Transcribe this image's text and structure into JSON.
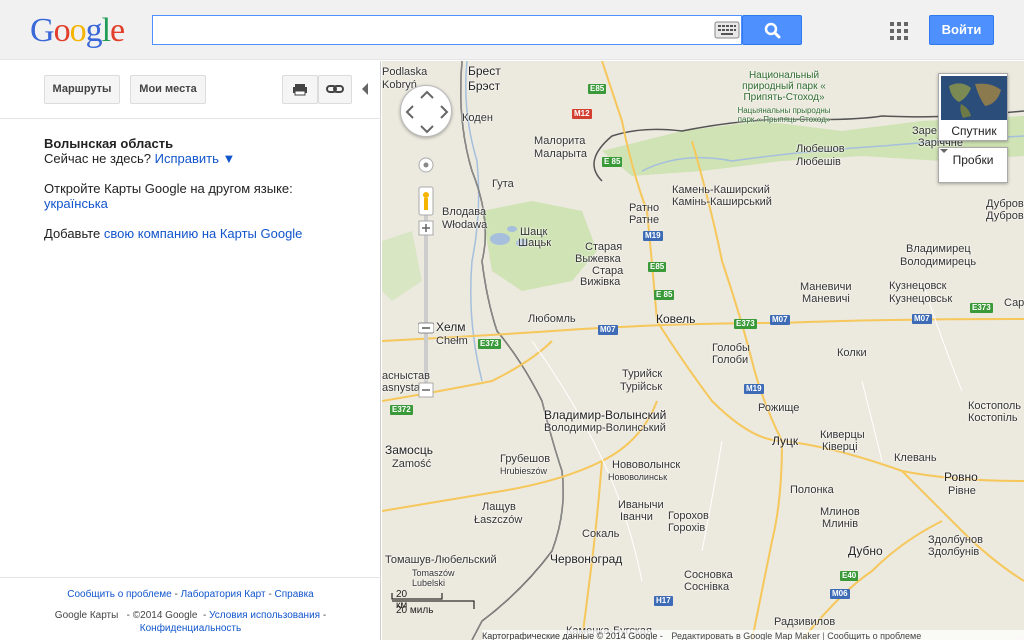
{
  "header": {
    "logo_letters": [
      "G",
      "o",
      "o",
      "g",
      "l",
      "e"
    ],
    "search_value": "",
    "signin_label": "Войти"
  },
  "panel": {
    "directions_label": "Маршруты",
    "my_places_label": "Мои места",
    "region_title": "Волынская область",
    "not_here_text": "Сейчас не здесь?",
    "fix_link": "Исправить ▼",
    "other_lang_text": "Откройте Карты Google на другом языке:",
    "lang_link": "українська",
    "add_text": "Добавьте",
    "add_link": "свою компанию на Карты Google"
  },
  "footer": {
    "report": "Сообщить о проблеме",
    "labs": "Лаборатория Карт",
    "help": "Справка",
    "product": "Google Карты",
    "copyright": "©2014 Google",
    "terms": "Условия использования",
    "privacy": "Конфиденциальность",
    "sep": " - "
  },
  "map": {
    "satellite_label": "Спутник",
    "traffic_label": "Пробки",
    "scale_km": "20 км",
    "scale_mi": "20 миль",
    "attribution": "Картографические данные © 2014 Google -",
    "edit_link": "Редактировать в Google Map Maker",
    "report_link": "Сообщить о проблеме",
    "colors": {
      "water": "#a5bfdd",
      "park": "#cfe3b4",
      "land": "#ece9de",
      "road": "#f6c75a",
      "border": "#555555"
    },
    "labels": [
      {
        "id": "podlaska",
        "t": "Podlaska"
      },
      {
        "id": "brest",
        "t": "Брест"
      },
      {
        "id": "brest2",
        "t": "Брэст"
      },
      {
        "id": "kobryn",
        "t": "Kobryń"
      },
      {
        "id": "kosen",
        "t": "Коден"
      },
      {
        "id": "maloryta",
        "t": "Малорита"
      },
      {
        "id": "maloryta2",
        "t": "Маларыта"
      },
      {
        "id": "park",
        "t": "Национальный природный парк « Припять-Стоход»"
      },
      {
        "id": "park2",
        "t": "Нацыянальны прыродны парк « Прыпяць-Стоход»"
      },
      {
        "id": "lubeshov",
        "t": "Любешов"
      },
      {
        "id": "lubeshov2",
        "t": "Любешів"
      },
      {
        "id": "zare",
        "t": "Заре"
      },
      {
        "id": "zare2",
        "t": "Заріччне"
      },
      {
        "id": "guta",
        "t": "Гута"
      },
      {
        "id": "kamen",
        "t": "Камень-Каширский"
      },
      {
        "id": "kamen2",
        "t": "Камінь-Каширський"
      },
      {
        "id": "ratno",
        "t": "Ратно"
      },
      {
        "id": "ratno2",
        "t": "Ратне"
      },
      {
        "id": "vlodava",
        "t": "Влодава"
      },
      {
        "id": "vlodava2",
        "t": "Włodawa"
      },
      {
        "id": "shatsk",
        "t": "Шацк"
      },
      {
        "id": "shatsk2",
        "t": "Шацьк"
      },
      {
        "id": "stara",
        "t": "Старая"
      },
      {
        "id": "vyzhev",
        "t": "Выжевка"
      },
      {
        "id": "stara2",
        "t": "Стара"
      },
      {
        "id": "vyzhev2",
        "t": "Вижівка"
      },
      {
        "id": "dubrov",
        "t": "Дубров"
      },
      {
        "id": "dubrov2",
        "t": "Дуброві"
      },
      {
        "id": "vladim",
        "t": "Владимирец"
      },
      {
        "id": "vladim2",
        "t": "Володимирець"
      },
      {
        "id": "manev",
        "t": "Маневичи"
      },
      {
        "id": "manev2",
        "t": "Маневичі"
      },
      {
        "id": "kuzn",
        "t": "Кузнецовск"
      },
      {
        "id": "kuzn2",
        "t": "Кузнецовськ"
      },
      {
        "id": "sar",
        "t": "Сар"
      },
      {
        "id": "kholm",
        "t": "Хелм"
      },
      {
        "id": "chelm",
        "t": "Chełm"
      },
      {
        "id": "lubom",
        "t": "Любомль"
      },
      {
        "id": "kovel",
        "t": "Ковель"
      },
      {
        "id": "goloby",
        "t": "Голобы"
      },
      {
        "id": "goloby2",
        "t": "Голоби"
      },
      {
        "id": "kolki",
        "t": "Колки"
      },
      {
        "id": "krasn",
        "t": "асныстав"
      },
      {
        "id": "krasn2",
        "t": "asnystaw"
      },
      {
        "id": "turiysk",
        "t": "Турийск"
      },
      {
        "id": "turiysk2",
        "t": "Турійськ"
      },
      {
        "id": "rozh",
        "t": "Рожище"
      },
      {
        "id": "kost",
        "t": "Костополь"
      },
      {
        "id": "kost2",
        "t": "Костопіль"
      },
      {
        "id": "vladvol",
        "t": "Владимир-Волынский"
      },
      {
        "id": "vladvol2",
        "t": "Володимир-Волинський"
      },
      {
        "id": "lutsk",
        "t": "Луцк"
      },
      {
        "id": "kiverc",
        "t": "Киверцы"
      },
      {
        "id": "kiverc2",
        "t": "Ківерці"
      },
      {
        "id": "zamosc",
        "t": "Замосць"
      },
      {
        "id": "zamosc2",
        "t": "Zamość"
      },
      {
        "id": "grub",
        "t": "Грубешов"
      },
      {
        "id": "grub2",
        "t": "Hrubieszów"
      },
      {
        "id": "novovol",
        "t": "Нововолынск"
      },
      {
        "id": "novovol2",
        "t": "Нововолинськ"
      },
      {
        "id": "klevan",
        "t": "Клевань"
      },
      {
        "id": "rovno",
        "t": "Ровно"
      },
      {
        "id": "rivne",
        "t": "Рівне"
      },
      {
        "id": "polonka",
        "t": "Полонка"
      },
      {
        "id": "ivan",
        "t": "Иванычи"
      },
      {
        "id": "ivan2",
        "t": "Іванчи"
      },
      {
        "id": "lasch",
        "t": "Лащув"
      },
      {
        "id": "lasch2",
        "t": "Łaszczów"
      },
      {
        "id": "sokal",
        "t": "Сокаль"
      },
      {
        "id": "goroh",
        "t": "Горохов"
      },
      {
        "id": "goroh2",
        "t": "Горохів"
      },
      {
        "id": "mlyn",
        "t": "Млинов"
      },
      {
        "id": "mlyn2",
        "t": "Млинів"
      },
      {
        "id": "zdolb",
        "t": "Здолбунов"
      },
      {
        "id": "zdolb2",
        "t": "Здолбунів"
      },
      {
        "id": "dubno",
        "t": "Дубно"
      },
      {
        "id": "tomash",
        "t": "Томашув-Любельский"
      },
      {
        "id": "tomash2",
        "t": "Tomaszów"
      },
      {
        "id": "tomash3",
        "t": "Lubelski"
      },
      {
        "id": "chervon",
        "t": "Червоноград"
      },
      {
        "id": "sosnov",
        "t": "Сосновка"
      },
      {
        "id": "sosnov2",
        "t": "Соснівка"
      },
      {
        "id": "radziv",
        "t": "Радзивилов"
      },
      {
        "id": "kamenb",
        "t": "Каменка-Бугская"
      }
    ],
    "shields": [
      {
        "id": "e85a",
        "t": "E85",
        "c": "green"
      },
      {
        "id": "m12",
        "t": "M12",
        "c": "red"
      },
      {
        "id": "e85b",
        "t": "E 85",
        "c": "green"
      },
      {
        "id": "m19a",
        "t": "M19",
        "c": "blue"
      },
      {
        "id": "e85c",
        "t": "E85",
        "c": "green"
      },
      {
        "id": "e85d",
        "t": "E 85",
        "c": "green"
      },
      {
        "id": "m07a",
        "t": "M07",
        "c": "blue"
      },
      {
        "id": "e373a",
        "t": "E373",
        "c": "green"
      },
      {
        "id": "m07b",
        "t": "M07",
        "c": "blue"
      },
      {
        "id": "m07c",
        "t": "M07",
        "c": "blue"
      },
      {
        "id": "e373b",
        "t": "E373",
        "c": "green"
      },
      {
        "id": "e373c",
        "t": "E373",
        "c": "green"
      },
      {
        "id": "e372",
        "t": "E372",
        "c": "green"
      },
      {
        "id": "m19b",
        "t": "M19",
        "c": "blue"
      },
      {
        "id": "e40",
        "t": "E40",
        "c": "green"
      },
      {
        "id": "h17",
        "t": "H17",
        "c": "blue"
      },
      {
        "id": "m06",
        "t": "M06",
        "c": "blue"
      }
    ]
  }
}
